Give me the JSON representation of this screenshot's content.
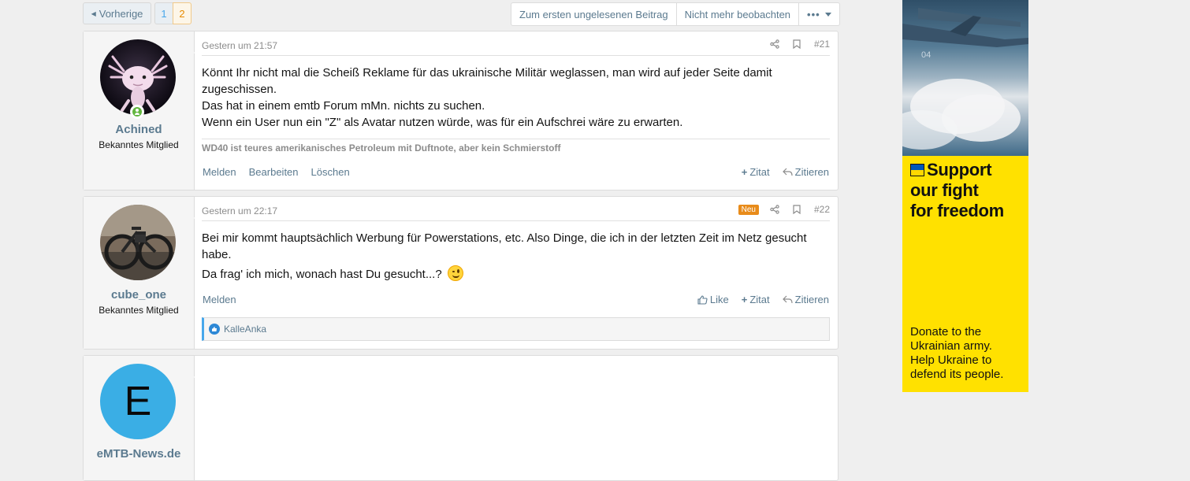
{
  "pagination": {
    "prev_label": "Vorherige",
    "pages": [
      "1",
      "2"
    ],
    "current_page": "2"
  },
  "thread_actions": {
    "first_unread": "Zum ersten ungelesenen Beitrag",
    "unwatch": "Nicht mehr beobachten",
    "more": "•••"
  },
  "posts": [
    {
      "username": "Achined",
      "user_title": "Bekanntes Mitglied",
      "online": true,
      "date": "Gestern um 21:57",
      "number": "#21",
      "lines": [
        "Könnt Ihr nicht mal die Scheiß Reklame für das ukrainische Militär weglassen, man wird auf jeder Seite damit zugeschissen.",
        "Das hat in einem emtb Forum mMn. nichts zu suchen.",
        "Wenn ein User nun ein \"Z\" als Avatar nutzen würde, was für ein Aufschrei wäre zu erwarten."
      ],
      "signature": "WD40 ist teures amerikanisches Petroleum mit Duftnote, aber kein Schmierstoff",
      "footer_left": [
        "Melden",
        "Bearbeiten",
        "Löschen"
      ],
      "footer_right": [
        "Zitat",
        "Zitieren"
      ]
    },
    {
      "username": "cube_one",
      "user_title": "Bekanntes Mitglied",
      "date": "Gestern um 22:17",
      "new_badge": "Neu",
      "number": "#22",
      "lines": [
        "Bei mir kommt hauptsächlich Werbung für Powerstations, etc. Also Dinge, die ich in der letzten Zeit im Netz gesucht habe.",
        "Da frag' ich mich, wonach hast Du gesucht...?"
      ],
      "footer_left": [
        "Melden"
      ],
      "footer_right": [
        "Like",
        "Zitat",
        "Zitieren"
      ],
      "reactions": "KalleAnka"
    },
    {
      "username": "eMTB-News.de",
      "avatar_letter": "E",
      "avatar_color": "#3aaee5"
    }
  ],
  "ad": {
    "photo_label": "04",
    "headline": [
      "Support",
      "our fight",
      "for freedom"
    ],
    "subtext": [
      "Donate to the",
      "Ukrainian army.",
      "Help Ukraine to",
      "defend its people."
    ]
  }
}
